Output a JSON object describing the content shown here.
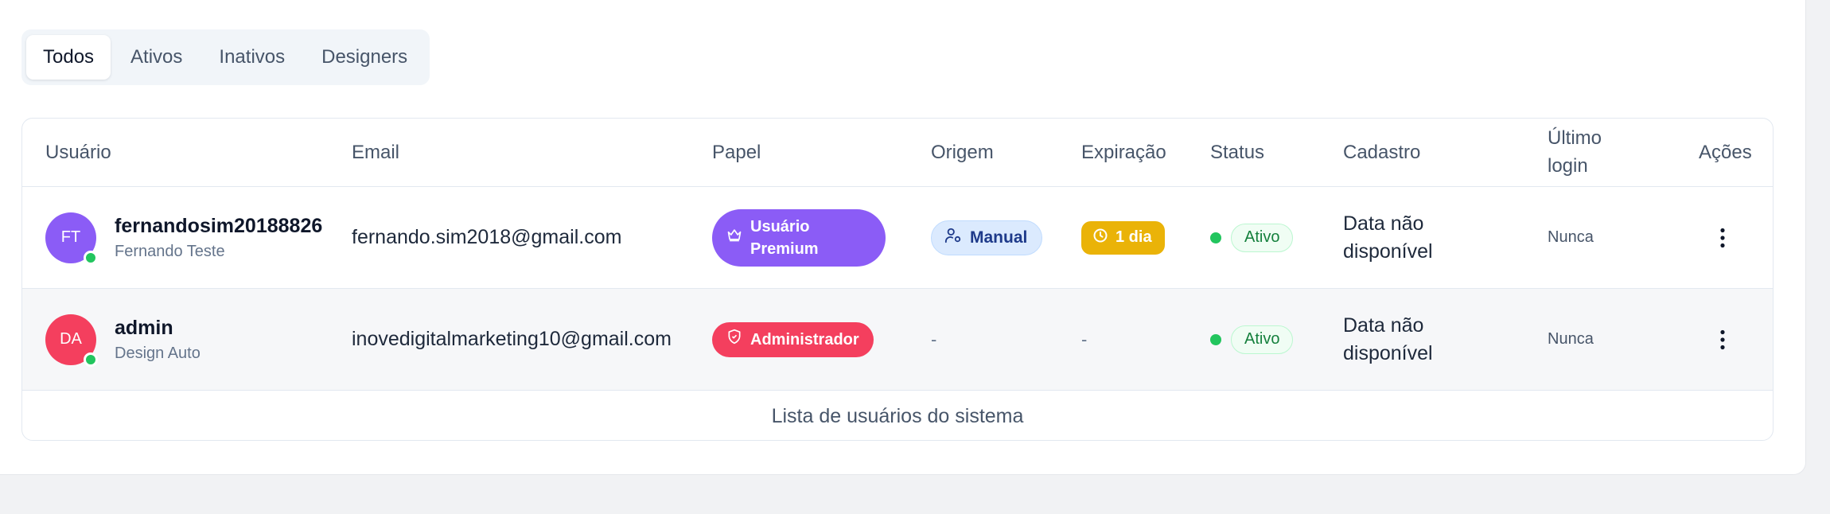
{
  "tabs": [
    {
      "label": "Todos",
      "active": true
    },
    {
      "label": "Ativos",
      "active": false
    },
    {
      "label": "Inativos",
      "active": false
    },
    {
      "label": "Designers",
      "active": false
    }
  ],
  "table": {
    "headers": {
      "usuario": "Usuário",
      "email": "Email",
      "papel": "Papel",
      "origem": "Origem",
      "expiracao": "Expiração",
      "status": "Status",
      "cadastro": "Cadastro",
      "ultimo_login": "Último login",
      "acoes": "Ações"
    },
    "rows": [
      {
        "initials": "FT",
        "avatar_color": "#8b5cf6",
        "username": "fernandosim20188826",
        "full_name": "Fernando Teste",
        "email": "fernando.sim2018@gmail.com",
        "role": "Usuário Premium",
        "role_color": "#8b5cf6",
        "role_icon": "crown-icon",
        "origin": "Manual",
        "origin_icon": "user-cog-icon",
        "expiration": "1 dia",
        "expiration_icon": "clock-icon",
        "status": "Ativo",
        "cadastro": "Data não disponível",
        "last_login": "Nunca"
      },
      {
        "initials": "DA",
        "avatar_color": "#f43f5e",
        "username": "admin",
        "full_name": "Design Auto",
        "email": "inovedigitalmarketing10@gmail.com",
        "role": "Administrador",
        "role_color": "#f43f5e",
        "role_icon": "shield-icon",
        "origin": "-",
        "expiration": "-",
        "status": "Ativo",
        "cadastro": "Data não disponível",
        "last_login": "Nunca"
      }
    ],
    "caption": "Lista de usuários do sistema"
  },
  "colors": {
    "online": "#22c55e",
    "status_active": "#15803d",
    "expiration_badge": "#eab308",
    "origin_badge_bg": "#dbeafe"
  }
}
